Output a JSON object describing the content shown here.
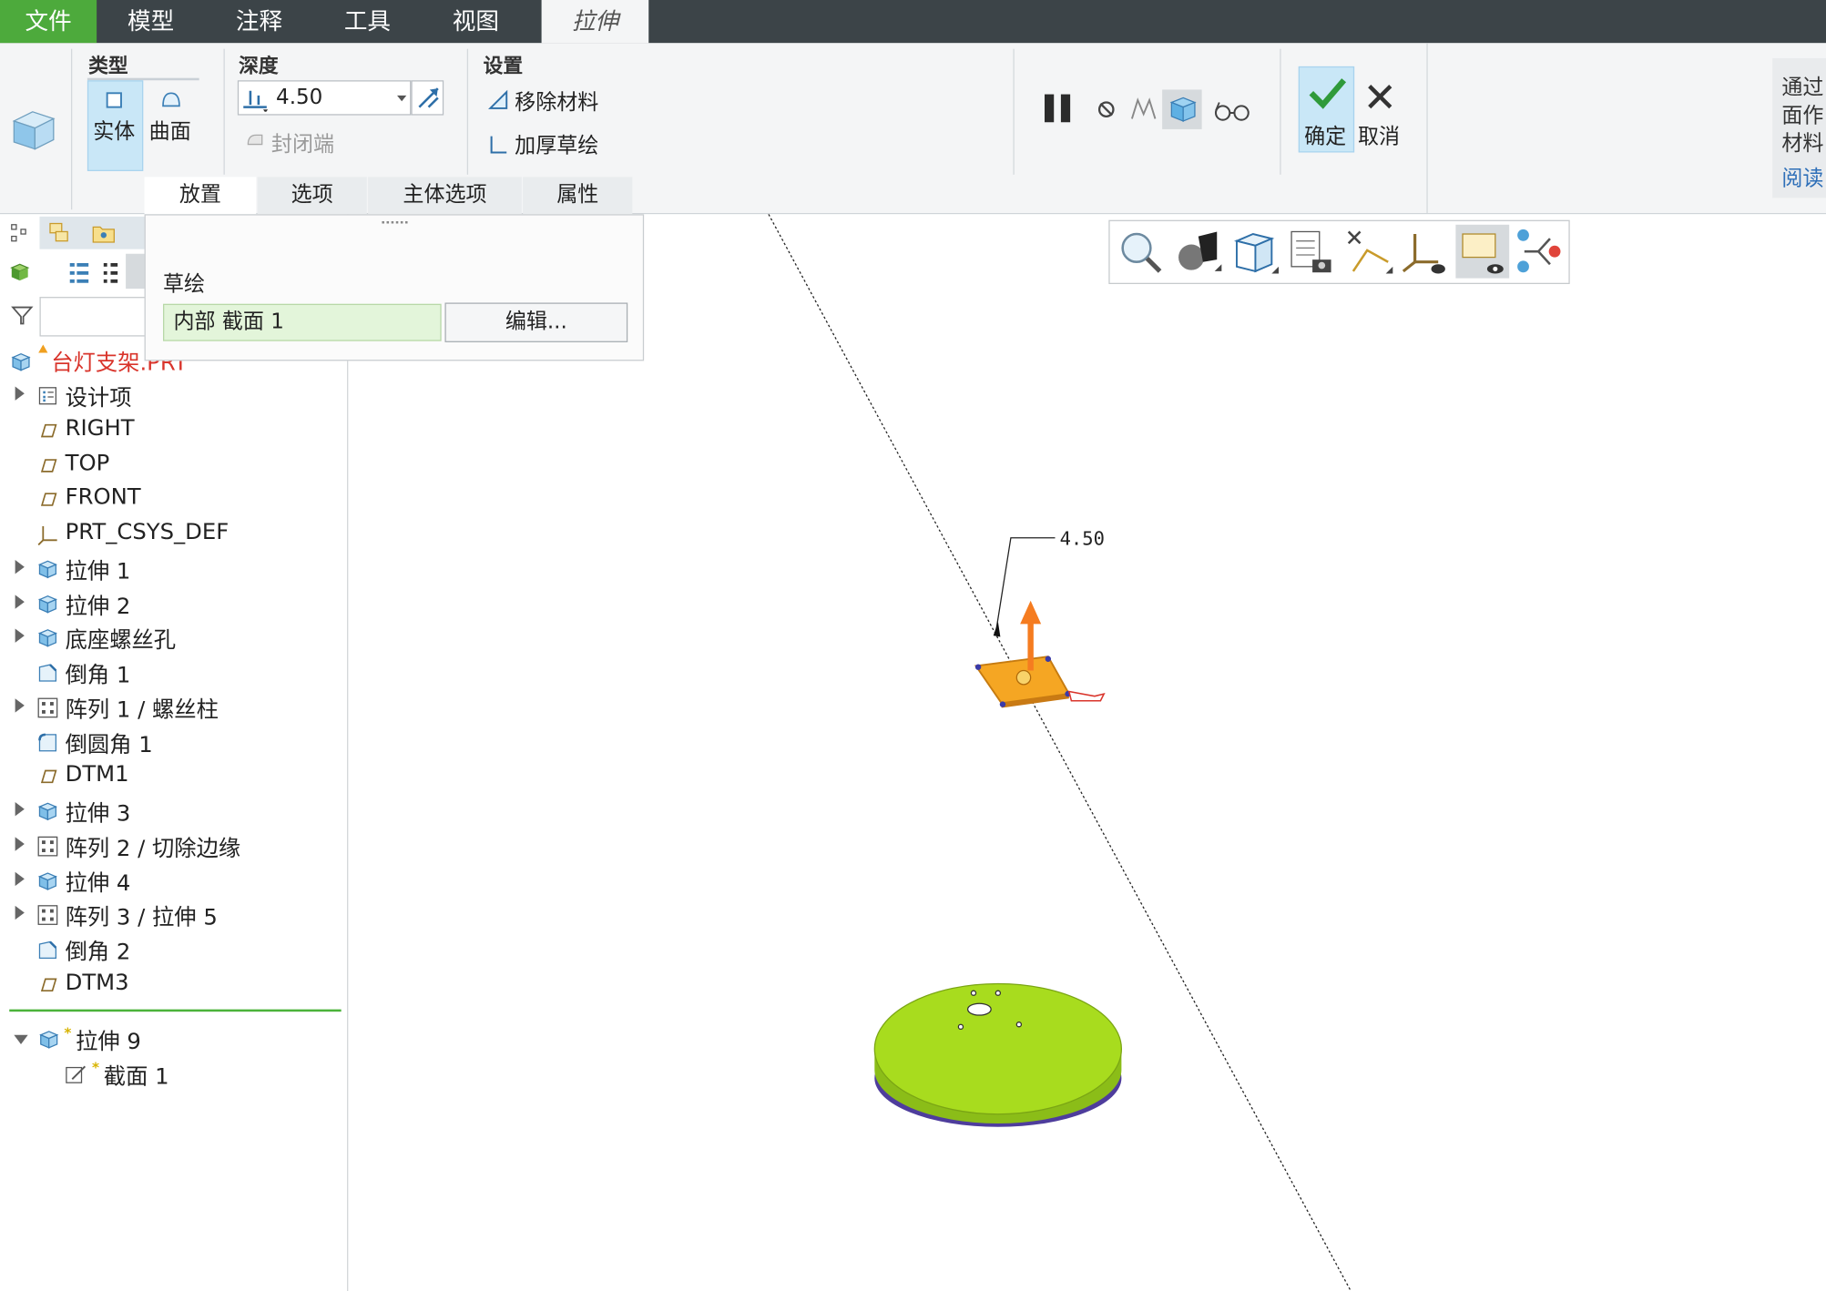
{
  "menu": {
    "file": "文件",
    "model": "模型",
    "annotate": "注释",
    "tools": "工具",
    "view": "视图",
    "extrude": "拉伸"
  },
  "ribbon": {
    "type_group": {
      "title": "类型",
      "solid": "实体",
      "surface": "曲面"
    },
    "depth_group": {
      "title": "深度",
      "value": "4.50",
      "capped_ends": "封闭端"
    },
    "settings_group": {
      "title": "设置",
      "remove_material": "移除材料",
      "thicken_sketch": "加厚草绘"
    },
    "tabs": [
      "放置",
      "选项",
      "主体选项",
      "属性"
    ],
    "confirm": "确定",
    "cancel": "取消",
    "hint": [
      "通过",
      "面作",
      "材料",
      "阅读"
    ]
  },
  "placement_panel": {
    "sketch_label": "草绘",
    "sketch_value": "内部 截面 1",
    "edit_button": "编辑..."
  },
  "model_tree": {
    "root": "台灯支架.PRT",
    "items": [
      {
        "label": "设计项",
        "icon": "design-items-icon",
        "expandable": true
      },
      {
        "label": "RIGHT",
        "icon": "datum-plane-icon",
        "expandable": false
      },
      {
        "label": "TOP",
        "icon": "datum-plane-icon",
        "expandable": false
      },
      {
        "label": "FRONT",
        "icon": "datum-plane-icon",
        "expandable": false
      },
      {
        "label": "PRT_CSYS_DEF",
        "icon": "csys-icon",
        "expandable": false
      },
      {
        "label": "拉伸 1",
        "icon": "extrude-icon",
        "expandable": true
      },
      {
        "label": "拉伸 2",
        "icon": "extrude-icon",
        "expandable": true
      },
      {
        "label": "底座螺丝孔",
        "icon": "extrude-icon",
        "expandable": true
      },
      {
        "label": "倒角 1",
        "icon": "chamfer-icon",
        "expandable": false
      },
      {
        "label": "阵列 1 / 螺丝柱",
        "icon": "pattern-icon",
        "expandable": true
      },
      {
        "label": "倒圆角 1",
        "icon": "round-icon",
        "expandable": false
      },
      {
        "label": "DTM1",
        "icon": "datum-plane-icon",
        "expandable": false
      },
      {
        "label": "拉伸 3",
        "icon": "extrude-icon",
        "expandable": true
      },
      {
        "label": "阵列 2 / 切除边缘",
        "icon": "pattern-icon",
        "expandable": true
      },
      {
        "label": "拉伸 4",
        "icon": "extrude-icon",
        "expandable": true
      },
      {
        "label": "阵列 3 / 拉伸 5",
        "icon": "pattern-icon",
        "expandable": true
      },
      {
        "label": "倒角 2",
        "icon": "chamfer-icon",
        "expandable": false
      },
      {
        "label": "DTM3",
        "icon": "datum-plane-icon",
        "expandable": false
      }
    ],
    "active_feature": "拉伸 9",
    "active_section": "截面 1",
    "new_marker": "*"
  },
  "viewport": {
    "dimension_label": "4.50",
    "base_color": "#a8dc1e",
    "preview_color": "#f5a623",
    "arrow_color": "#f57c20"
  },
  "colors": {
    "menubar": "#3c4448",
    "file_tab": "#4daa3c",
    "selected_button": "#c9e7f7",
    "insert_line": "#4bb33a"
  }
}
